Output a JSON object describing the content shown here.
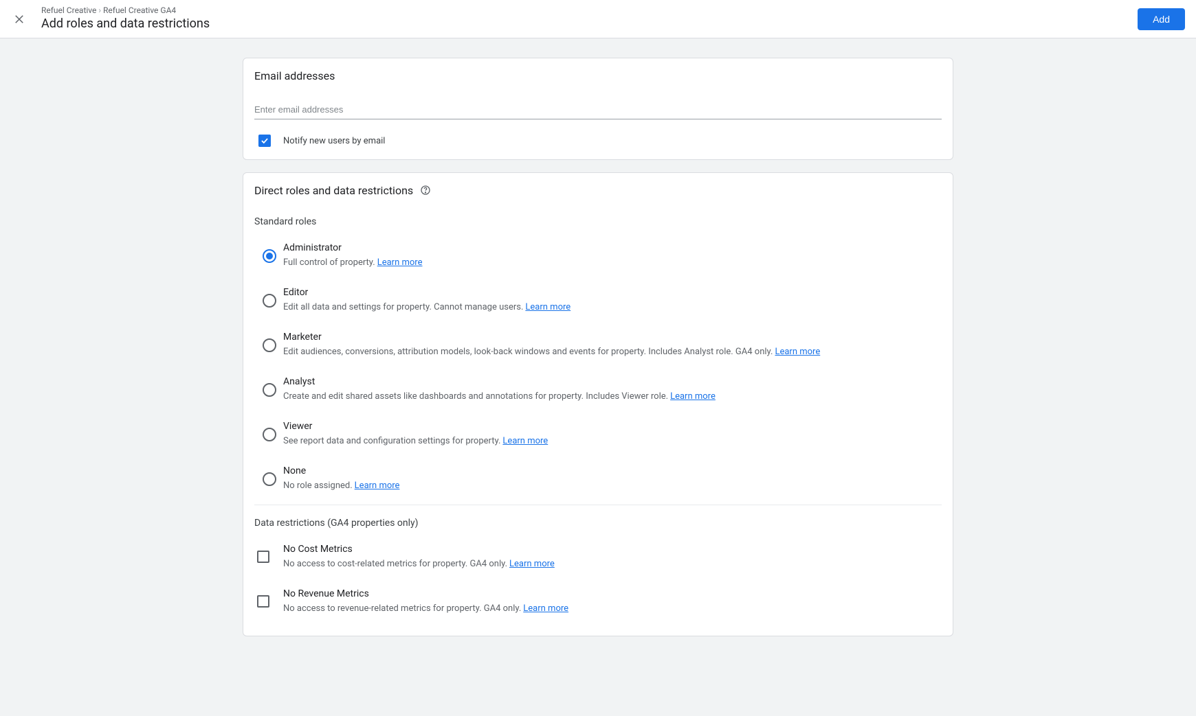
{
  "header": {
    "breadcrumb1": "Refuel Creative",
    "breadcrumb2": "Refuel Creative GA4",
    "title": "Add roles and data restrictions",
    "add_label": "Add"
  },
  "email_card": {
    "title": "Email addresses",
    "placeholder": "Enter email addresses",
    "notify_label": "Notify new users by email",
    "notify_checked": true
  },
  "roles_card": {
    "title": "Direct roles and data restrictions",
    "standard_roles_label": "Standard roles",
    "learn_more": "Learn more",
    "roles": [
      {
        "title": "Administrator",
        "desc": "Full control of property.",
        "selected": true
      },
      {
        "title": "Editor",
        "desc": "Edit all data and settings for property. Cannot manage users.",
        "selected": false
      },
      {
        "title": "Marketer",
        "desc": "Edit audiences, conversions, attribution models, look-back windows and events for property. Includes Analyst role. GA4 only.",
        "selected": false
      },
      {
        "title": "Analyst",
        "desc": "Create and edit shared assets like dashboards and annotations for property. Includes Viewer role.",
        "selected": false
      },
      {
        "title": "Viewer",
        "desc": "See report data and configuration settings for property.",
        "selected": false
      },
      {
        "title": "None",
        "desc": "No role assigned.",
        "selected": false
      }
    ],
    "data_restrictions_label": "Data restrictions (GA4 properties only)",
    "restrictions": [
      {
        "title": "No Cost Metrics",
        "desc": "No access to cost-related metrics for property. GA4 only.",
        "checked": false
      },
      {
        "title": "No Revenue Metrics",
        "desc": "No access to revenue-related metrics for property. GA4 only.",
        "checked": false
      }
    ]
  }
}
